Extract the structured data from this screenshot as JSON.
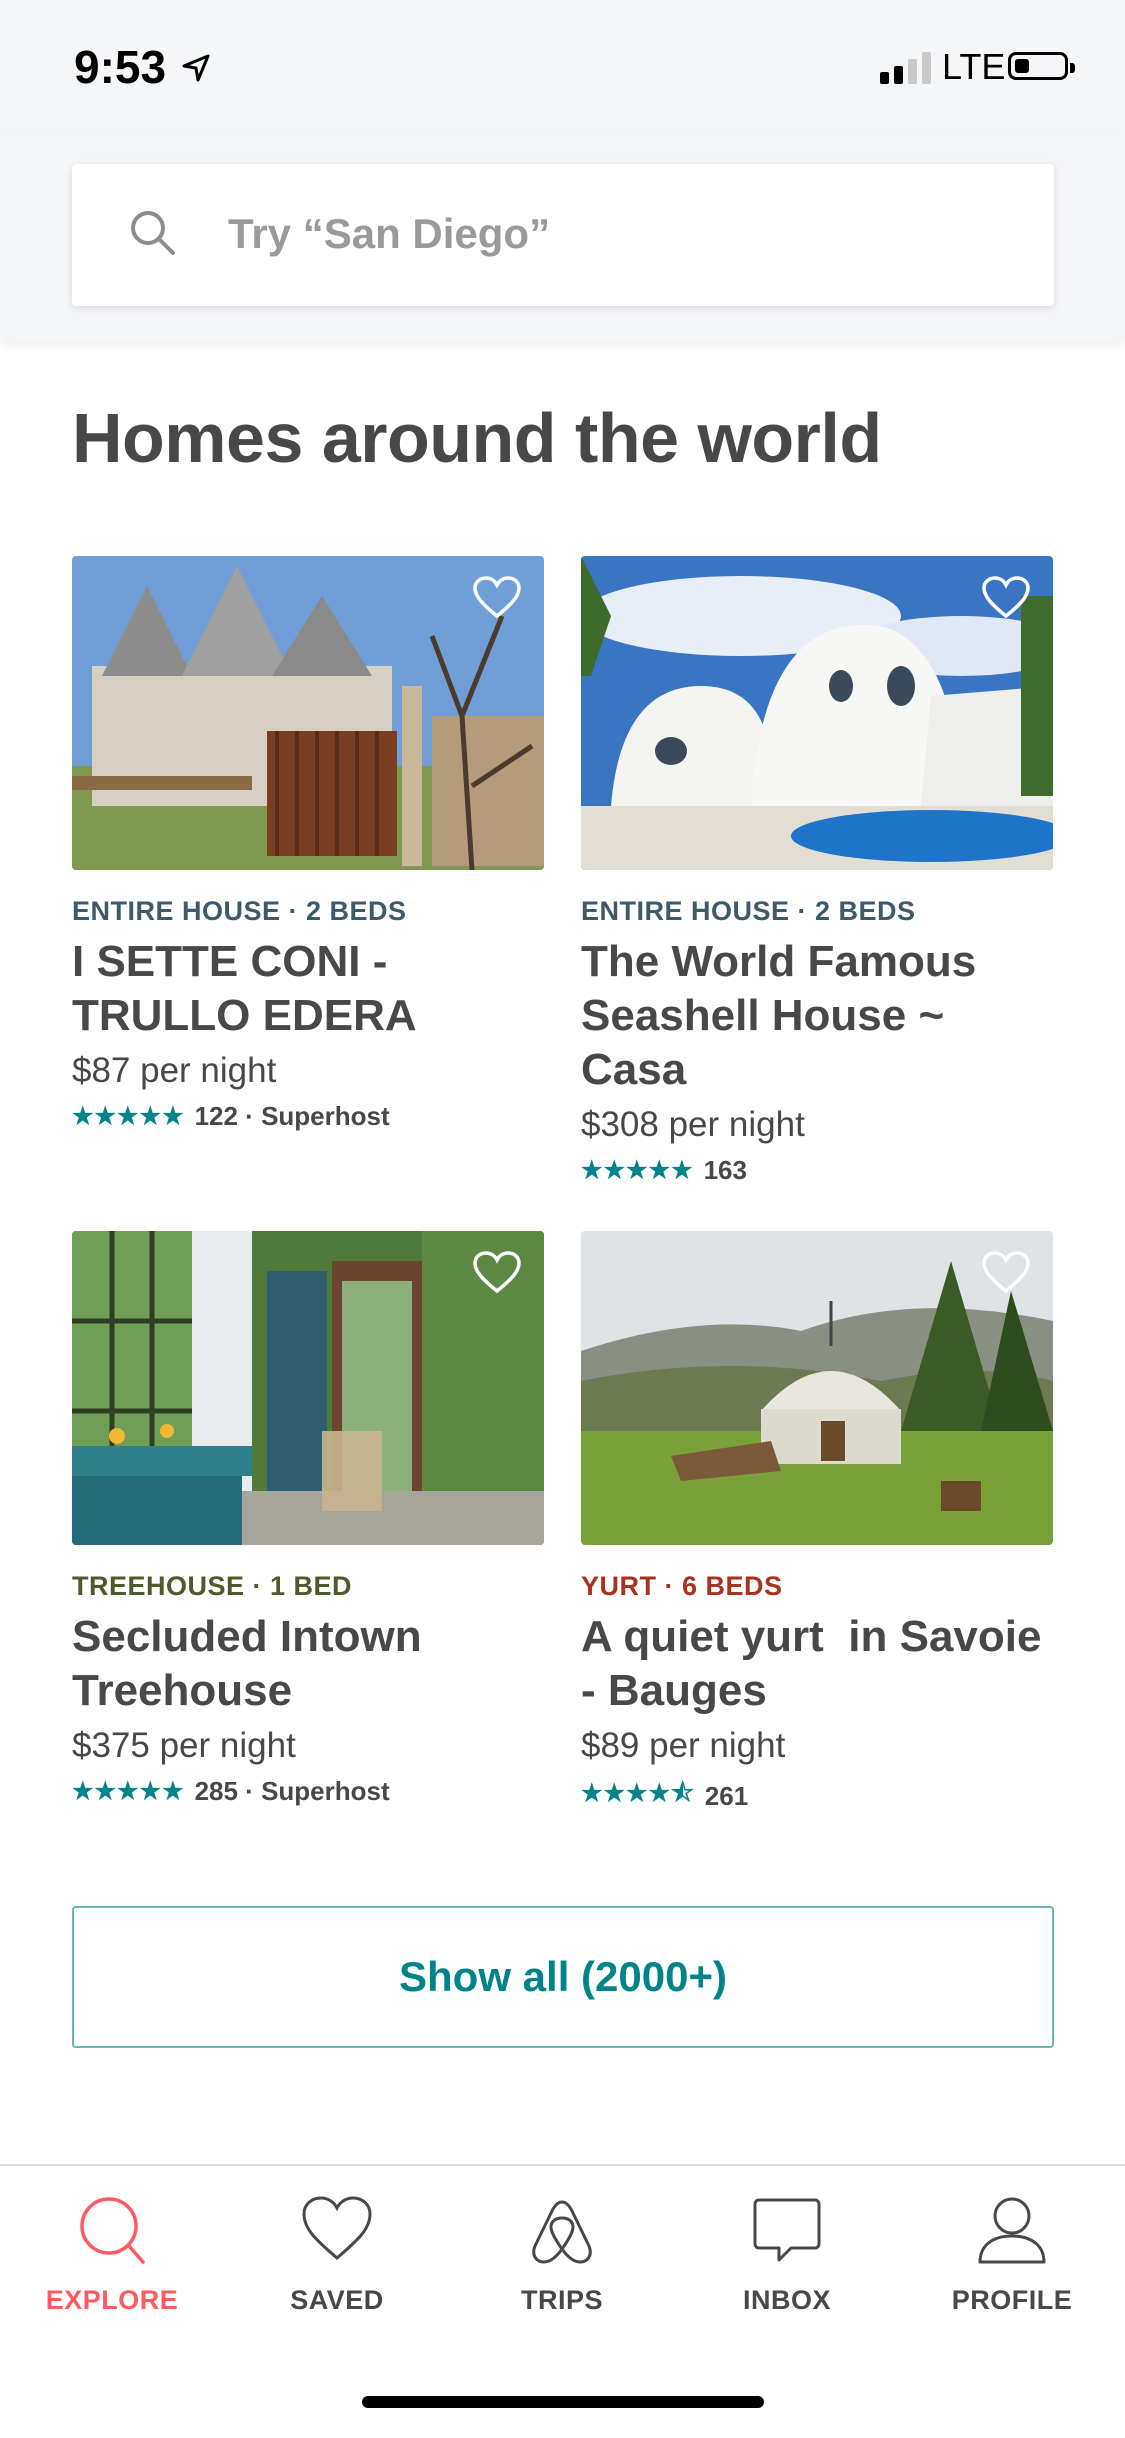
{
  "status_bar": {
    "time": "9:53",
    "network": "LTE"
  },
  "search": {
    "placeholder": "Try “San Diego”"
  },
  "section": {
    "title": "Homes around the world"
  },
  "colors": {
    "accent": "#FF5A5F",
    "teal": "#008489",
    "text": "#484848"
  },
  "listings": [
    {
      "kind": "ENTIRE HOUSE · 2 BEDS",
      "kind_color": "#3d5a6b",
      "name": "I SETTE CONI - TRULLO EDERA",
      "price": "$87 per night",
      "stars": "★★★★★",
      "rating_value": 5,
      "reviews": "122 · Superhost"
    },
    {
      "kind": "ENTIRE HOUSE · 2 BEDS",
      "kind_color": "#3d5a6b",
      "name": "The World Famous Seashell House ~ Casa",
      "price": "$308 per night",
      "stars": "★★★★★",
      "rating_value": 5,
      "reviews": "163"
    },
    {
      "kind": "TREEHOUSE · 1 BED",
      "kind_color": "#4d5a2a",
      "name": "Secluded Intown Treehouse",
      "price": "$375 per night",
      "stars": "★★★★★",
      "rating_value": 5,
      "reviews": "285 · Superhost"
    },
    {
      "kind": "YURT · 6 BEDS",
      "kind_color": "#a8321e",
      "name": "A quiet yurt  in Savoie - Bauges",
      "price": "$89 per night",
      "stars": "★★★★⯪",
      "rating_value": 4.5,
      "reviews": "261"
    }
  ],
  "show_all": {
    "label": "Show all (2000+)"
  },
  "tabs": [
    {
      "label": "EXPLORE",
      "icon": "search-icon",
      "active": true
    },
    {
      "label": "SAVED",
      "icon": "heart-icon",
      "active": false
    },
    {
      "label": "TRIPS",
      "icon": "airbnb-logo-icon",
      "active": false
    },
    {
      "label": "INBOX",
      "icon": "message-icon",
      "active": false
    },
    {
      "label": "PROFILE",
      "icon": "user-icon",
      "active": false
    }
  ]
}
